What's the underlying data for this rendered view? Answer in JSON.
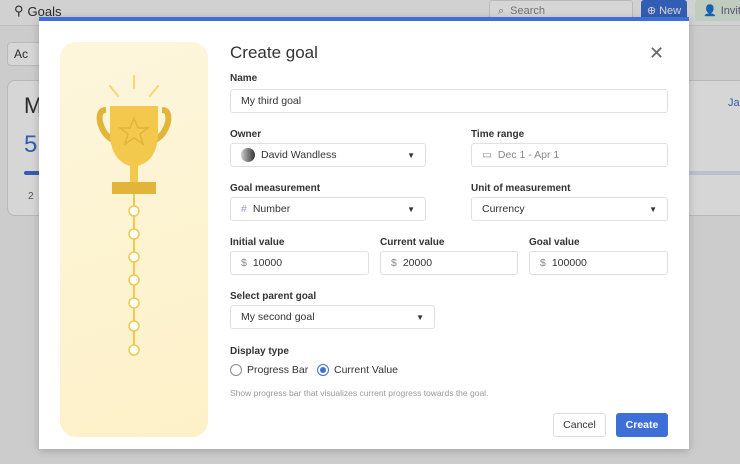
{
  "background": {
    "title": "Goals",
    "search_placeholder": "Search",
    "new_label": "New",
    "invite_label": "Invite",
    "ac_label": "Ac",
    "card_title": "M",
    "card_value": "5",
    "card_sub": "2",
    "card_right": "Ja",
    "card_progress": 0.03
  },
  "modal": {
    "title": "Create goal",
    "name_label": "Name",
    "name_value": "My third goal",
    "owner_label": "Owner",
    "owner_value": "David Wandless",
    "time_label": "Time range",
    "time_value": "Dec 1 - Apr 1",
    "measure_label": "Goal measurement",
    "measure_value": "Number",
    "unit_label": "Unit of measurement",
    "unit_value": "Currency",
    "initial_label": "Initial value",
    "initial_value": "10000",
    "current_label": "Current value",
    "current_value": "20000",
    "goal_label": "Goal value",
    "goal_value": "100000",
    "currency_symbol": "$",
    "parent_label": "Select parent goal",
    "parent_value": "My second goal",
    "display_label": "Display type",
    "display_options": [
      "Progress Bar",
      "Current Value"
    ],
    "display_selected": "Current Value",
    "hint": "Show progress bar that visualizes current progress towards the goal.",
    "cancel": "Cancel",
    "create": "Create"
  },
  "colors": {
    "accent": "#3d6fd6",
    "trophy": "#f2c94c"
  }
}
